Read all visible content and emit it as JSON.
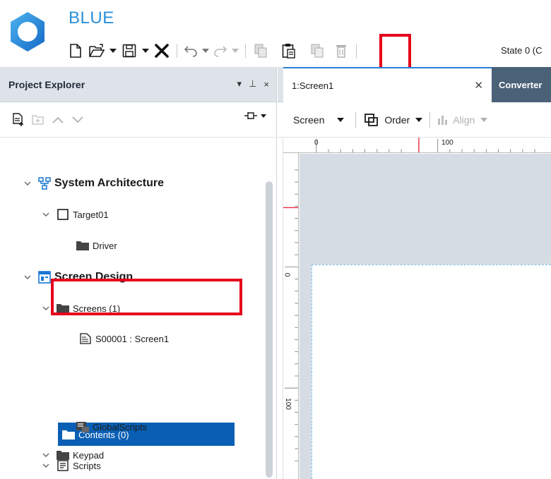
{
  "app": {
    "title": "BLUE",
    "state_label": "State 0 (C"
  },
  "toolbar": {
    "items": [
      "new-file",
      "open-folder",
      "save",
      "close",
      "undo",
      "redo",
      "copy",
      "paste",
      "duplicate",
      "delete"
    ]
  },
  "project_explorer": {
    "title": "Project Explorer",
    "controls": {
      "dropdown": "▾",
      "pin": "⊥",
      "close": "×"
    }
  },
  "tree": {
    "system_architecture": "System Architecture",
    "target": "Target01",
    "driver": "Driver",
    "screen_design": "Screen Design",
    "screens": "Screens (1)",
    "screen_item": "S00001 : Screen1",
    "contents": "Contents (0)",
    "scripts": "Scripts",
    "global_scripts": "GlobalScripts",
    "keypad": "Keypad"
  },
  "editor": {
    "active_tab": "1:Screen1",
    "inactive_tab": "Converter",
    "screen_dropdown": "Screen",
    "order_label": "Order",
    "align_label": "Align"
  },
  "ruler": {
    "top_labels": [
      "0",
      "100"
    ],
    "left_labels": [
      "0",
      "100"
    ]
  },
  "colors": {
    "accent": "#2a8fd8",
    "selection": "#0a5fb4",
    "highlight": "#e5001b",
    "panel_header": "#dde3e9",
    "canvas_gray": "#d6dce3"
  }
}
